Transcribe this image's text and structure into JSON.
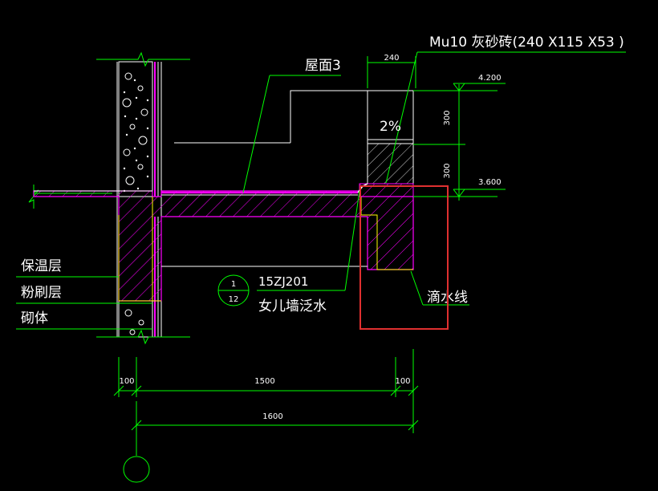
{
  "labels": {
    "material": "Mu10  灰砂砖(240 X115 X53 )",
    "roof": "屋面3",
    "slope": "2%",
    "insulation": "保温层",
    "plaster": "粉刷层",
    "masonry": "砌体",
    "drip_line": "滴水线",
    "ref_code": "15ZJ201",
    "ref_name": "女儿墙泛水",
    "detail_num": "1",
    "sheet_num": "12"
  },
  "dimensions": {
    "parapet_width": "240",
    "height_top": "300",
    "height_bottom": "300",
    "level_top": "4.200",
    "level_bottom": "3.600",
    "dim_left": "100",
    "dim_mid": "1500",
    "dim_right": "100",
    "dim_total": "1600"
  },
  "colors": {
    "line": "#00ff00",
    "slab": "#ff00ff",
    "edge": "#ffff00",
    "highlight": "#e03030",
    "text": "#ffffff",
    "background": "#000000"
  }
}
